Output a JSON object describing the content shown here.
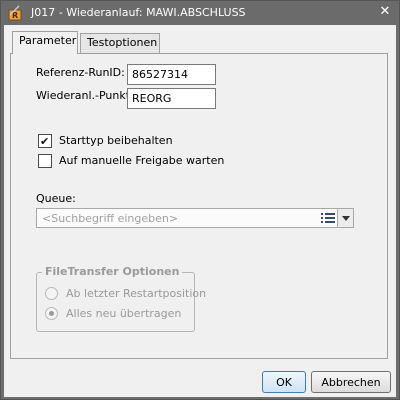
{
  "window": {
    "title": "J017 - Wiederanlauf: MAWI.ABSCHLUSS",
    "close_glyph": "✕"
  },
  "tabs": [
    {
      "label": "Parameter",
      "active": true
    },
    {
      "label": "Testoptionen",
      "active": false
    }
  ],
  "fields": {
    "run_id": {
      "label": "Referenz-RunID:",
      "value": "86527314"
    },
    "restart_point": {
      "label": "Wiederanl.-Punkt:",
      "value": "REORG"
    }
  },
  "checkboxes": [
    {
      "label": "Starttyp beibehalten",
      "checked": true
    },
    {
      "label": "Auf manuelle Freigabe warten",
      "checked": false
    }
  ],
  "queue": {
    "label": "Queue:",
    "placeholder": "<Suchbegriff eingeben>",
    "value": ""
  },
  "filetransfer": {
    "title": "FileTransfer Optionen",
    "options": [
      {
        "label": "Ab letzter Restartposition",
        "selected": false,
        "enabled": false
      },
      {
        "label": "Alles neu übertragen",
        "selected": true,
        "enabled": false
      }
    ]
  },
  "buttons": {
    "ok": "OK",
    "cancel": "Abbrechen"
  },
  "colors": {
    "titlebar": "#6b6b6b",
    "client_bg": "#f0f0f0",
    "default_button_border": "#3c7fb1",
    "disabled_text": "#9a9a9a"
  }
}
